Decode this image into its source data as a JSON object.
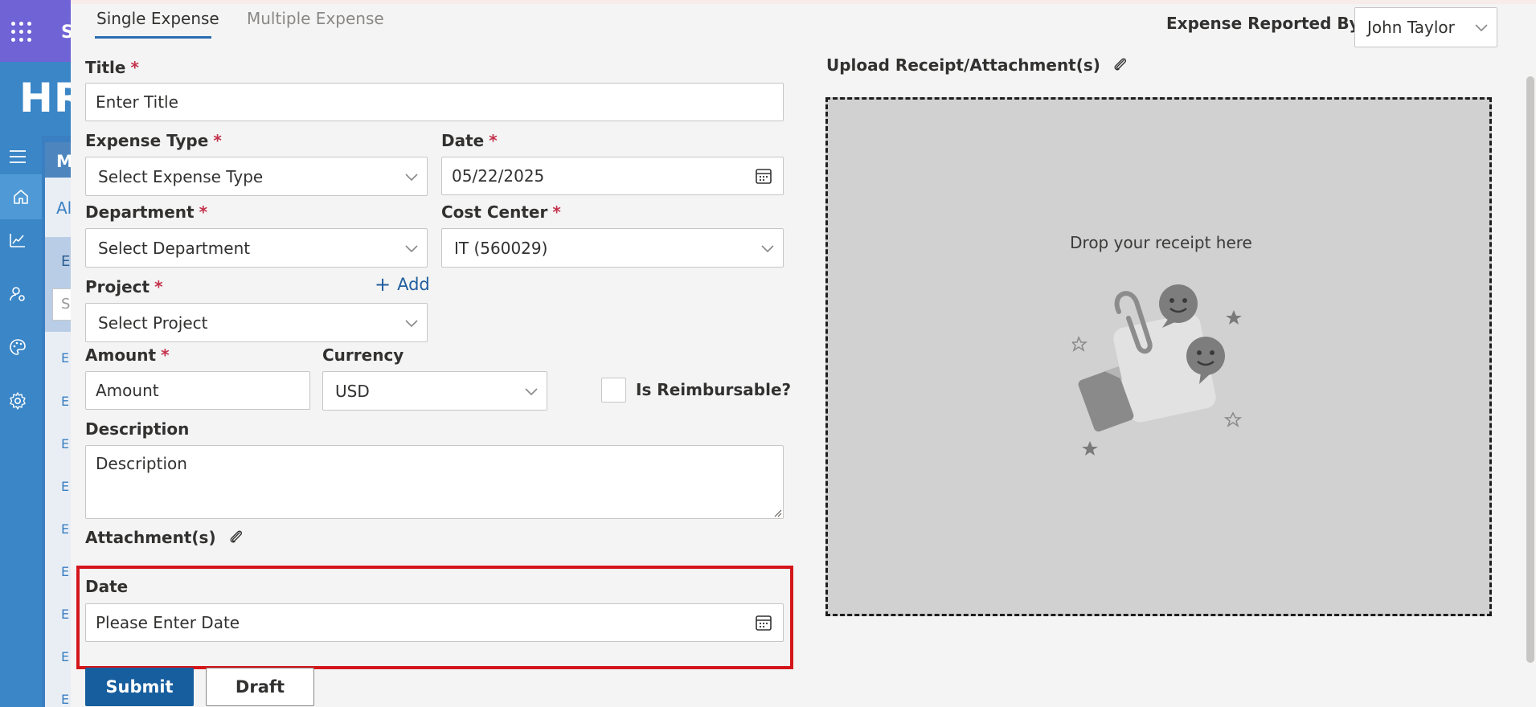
{
  "background": {
    "app_letter": "S",
    "hr_title": "HR",
    "panel_letter": "M",
    "tab_letter": "Al",
    "band_letter": "E",
    "search_letter": "S",
    "row_letters": [
      "E",
      "E",
      "E",
      "E",
      "E",
      "E",
      "E",
      "E",
      "E"
    ]
  },
  "tabs": {
    "single": "Single Expense",
    "multiple": "Multiple Expense"
  },
  "reported_by": {
    "label": "Expense Reported By",
    "required": "*",
    "value": "John Taylor"
  },
  "form": {
    "title": {
      "label": "Title",
      "required": "*",
      "placeholder": "Enter Title"
    },
    "expense_type": {
      "label": "Expense Type",
      "required": "*",
      "placeholder": "Select Expense Type"
    },
    "date": {
      "label": "Date",
      "required": "*",
      "value": "05/22/2025"
    },
    "department": {
      "label": "Department",
      "required": "*",
      "placeholder": "Select Department"
    },
    "cost_center": {
      "label": "Cost Center",
      "required": "*",
      "value": "IT (560029)"
    },
    "project": {
      "label": "Project",
      "required": "*",
      "placeholder": "Select Project",
      "add_label": "Add"
    },
    "amount": {
      "label": "Amount",
      "required": "*",
      "placeholder": "Amount"
    },
    "currency": {
      "label": "Currency",
      "value": "USD"
    },
    "reimbursable": {
      "label": "Is Reimbursable?",
      "checked": false
    },
    "description": {
      "label": "Description",
      "placeholder": "Description"
    },
    "attachments": {
      "label": "Attachment(s)"
    },
    "extra_date": {
      "label": "Date",
      "placeholder": "Please Enter Date"
    }
  },
  "buttons": {
    "submit": "Submit",
    "draft": "Draft"
  },
  "upload": {
    "label": "Upload Receipt/Attachment(s)",
    "drop_text": "Drop your receipt here"
  },
  "colors": {
    "primary": "#175e9e",
    "required": "#c4314b",
    "highlight": "#d4161c",
    "app_bar": "#6f63d6",
    "header": "#3a86c7"
  },
  "icons": [
    "waffle-icon",
    "hamburger-icon",
    "home-icon",
    "chart-icon",
    "user-settings-icon",
    "palette-icon",
    "gear-icon",
    "calendar-icon",
    "chevron-down-icon",
    "paperclip-icon",
    "plus-icon"
  ]
}
